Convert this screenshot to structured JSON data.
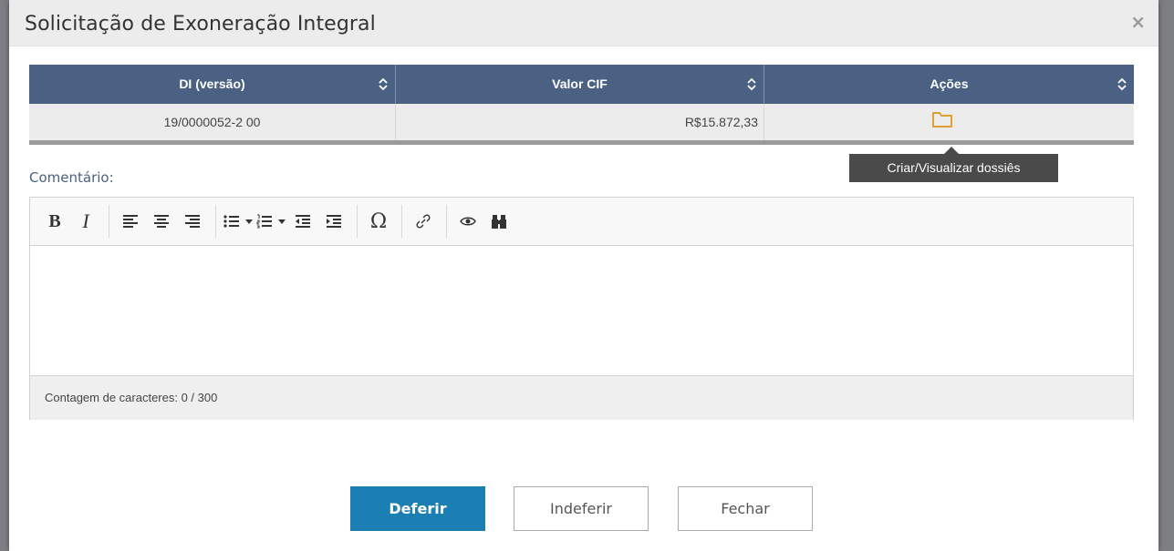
{
  "dialog": {
    "title": "Solicitação de Exoneração Integral",
    "close_label": "×"
  },
  "table": {
    "columns": [
      "DI (versão)",
      "Valor CIF",
      "Ações"
    ],
    "rows": [
      {
        "di": "19/0000052-2 00",
        "valor_cif": "R$15.872,33",
        "action_icon": "folder-icon"
      }
    ]
  },
  "tooltip": "Criar/Visualizar dossiês",
  "comment": {
    "label": "Comentário:",
    "toolbar": {
      "bold": "B",
      "italic": "I",
      "special_char": "Ω",
      "icons": [
        "align-left-icon",
        "align-center-icon",
        "align-right-icon",
        "bullet-list-icon",
        "numbered-list-icon",
        "outdent-icon",
        "indent-icon",
        "special-char-icon",
        "link-icon",
        "preview-icon",
        "find-icon"
      ]
    },
    "char_count": "Contagem de caracteres: 0 / 300"
  },
  "buttons": {
    "approve": "Deferir",
    "reject": "Indeferir",
    "close": "Fechar"
  },
  "colors": {
    "header": "#4a6183",
    "primary": "#1b7fb4",
    "folder": "#e0a030",
    "tooltip": "#4a4a4a"
  }
}
